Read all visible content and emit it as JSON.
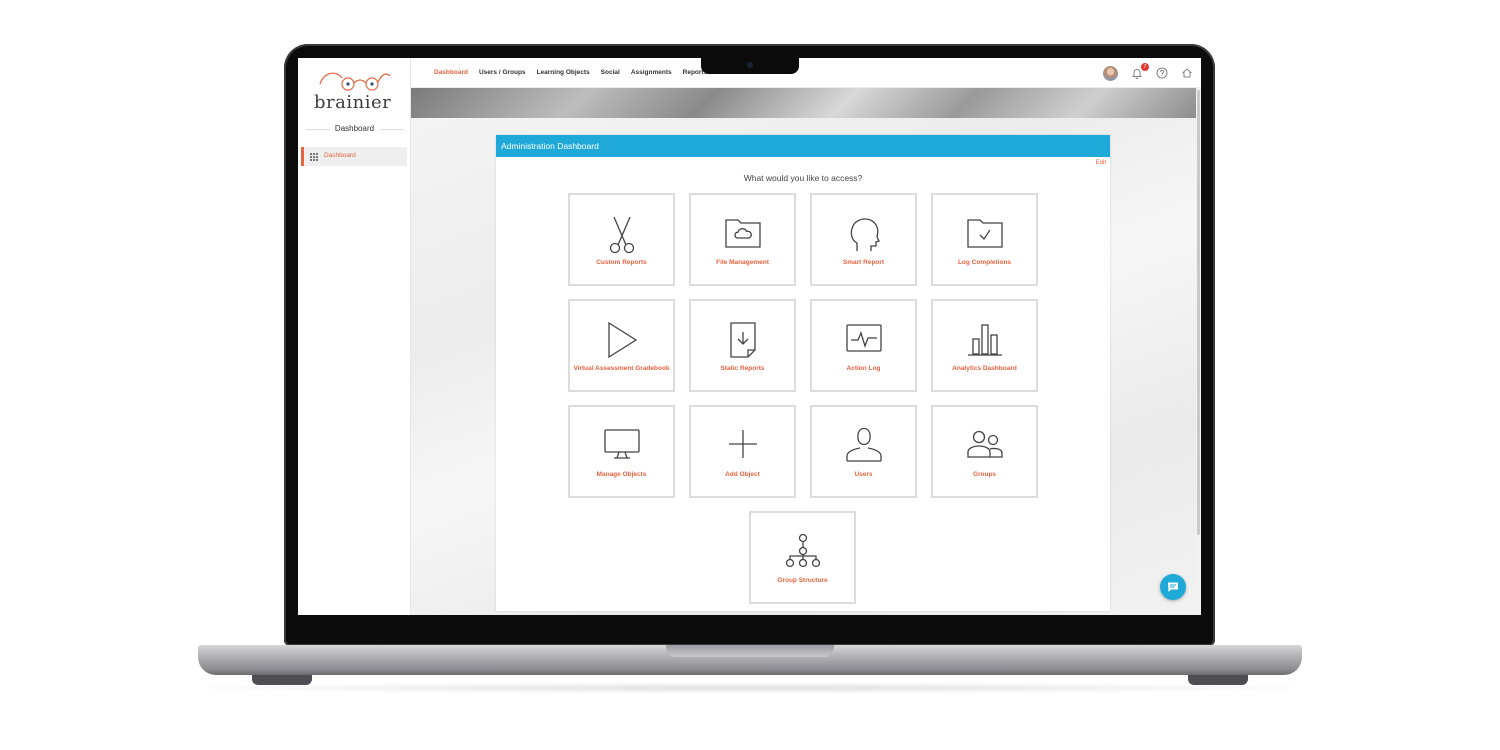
{
  "app": {
    "logo_text": "brainier"
  },
  "sidebar": {
    "title": "Dashboard",
    "items": [
      {
        "label": "Dashboard",
        "icon": "grid-icon",
        "active": true
      }
    ]
  },
  "topnav": {
    "items": [
      {
        "label": "Dashboard",
        "active": true
      },
      {
        "label": "Users / Groups",
        "active": false
      },
      {
        "label": "Learning Objects",
        "active": false
      },
      {
        "label": "Social",
        "active": false
      },
      {
        "label": "Assignments",
        "active": false
      },
      {
        "label": "Reports",
        "active": false
      }
    ],
    "notification_count": "7",
    "icons": [
      "avatar",
      "bell-icon",
      "help-icon",
      "home-icon"
    ]
  },
  "panel": {
    "title": "Administration Dashboard",
    "edit_label": "Edit",
    "question": "What would you like to access?",
    "tiles": [
      {
        "label": "Custom Reports",
        "icon": "scissors-icon"
      },
      {
        "label": "File Management",
        "icon": "folder-cloud-icon"
      },
      {
        "label": "Smart Report",
        "icon": "head-profile-icon"
      },
      {
        "label": "Log Completions",
        "icon": "folder-check-icon"
      },
      {
        "label": "Virtual Assessment Gradebook",
        "icon": "play-icon"
      },
      {
        "label": "Static Reports",
        "icon": "document-download-icon"
      },
      {
        "label": "Action Log",
        "icon": "pulse-monitor-icon"
      },
      {
        "label": "Analytics Dashboard",
        "icon": "bar-chart-icon"
      },
      {
        "label": "Manage Objects",
        "icon": "monitor-icon"
      },
      {
        "label": "Add Object",
        "icon": "plus-icon"
      },
      {
        "label": "Users",
        "icon": "user-icon"
      },
      {
        "label": "Groups",
        "icon": "group-icon"
      },
      {
        "label": "Group Structure",
        "icon": "hierarchy-icon"
      }
    ]
  },
  "colors": {
    "accent": "#e8643f",
    "header_blue": "#1ea9d8",
    "tile_border": "#dcdcdc"
  }
}
